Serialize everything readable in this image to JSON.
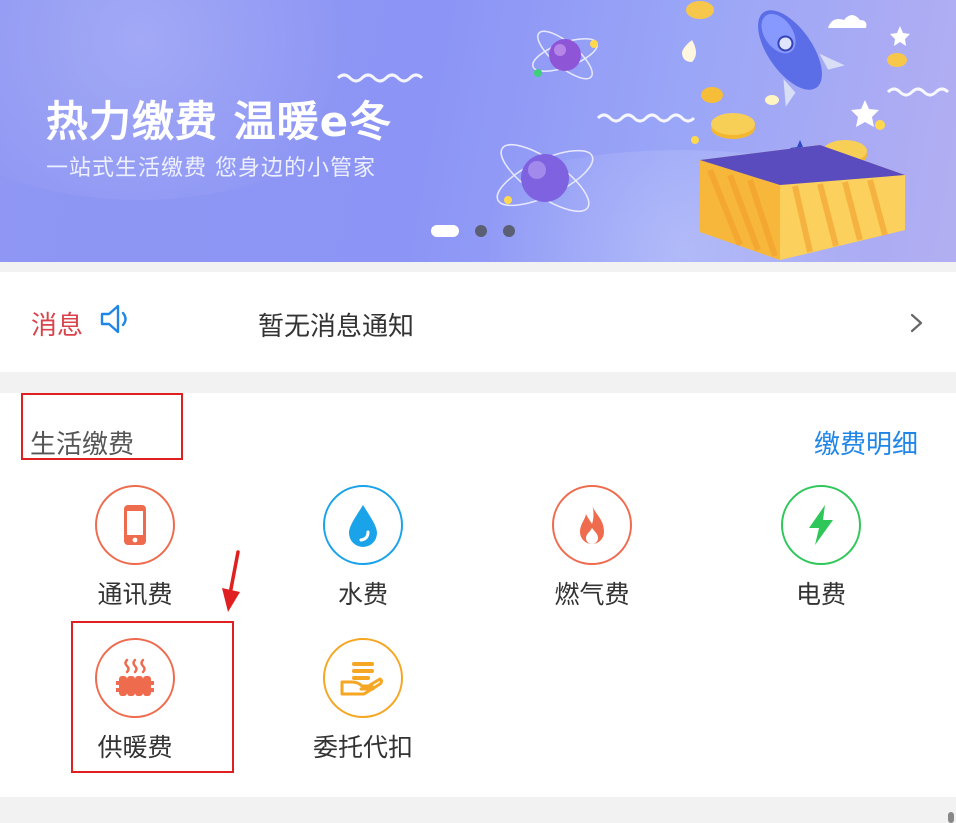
{
  "banner": {
    "title": "热力缴费 温暖e冬",
    "subtitle": "一站式生活缴费 您身边的小管家",
    "slide_count": 3,
    "active_slide": 1
  },
  "message": {
    "label": "消息",
    "icon": "speaker-icon",
    "text": "暂无消息通知",
    "arrow_icon": "chevron-right-icon"
  },
  "payments": {
    "title": "生活缴费",
    "detail_link": "缴费明细",
    "items": [
      {
        "label": "通讯费",
        "icon": "phone-icon",
        "color": "#ef6b4d"
      },
      {
        "label": "水费",
        "icon": "water-drop-icon",
        "color": "#1aa3e8"
      },
      {
        "label": "燃气费",
        "icon": "flame-icon",
        "color": "#ef6b4d"
      },
      {
        "label": "电费",
        "icon": "lightning-icon",
        "color": "#2fc75a"
      },
      {
        "label": "供暖费",
        "icon": "radiator-icon",
        "color": "#ef6b4d"
      },
      {
        "label": "委托代扣",
        "icon": "hand-money-icon",
        "color": "#f5a623"
      }
    ]
  },
  "colors": {
    "accent_blue": "#1f86e8",
    "message_red": "#d9434b",
    "annotation_red": "#e02020"
  }
}
